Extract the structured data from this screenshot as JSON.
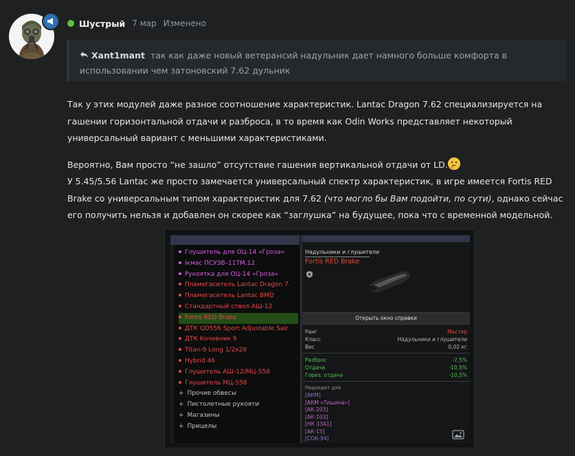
{
  "post": {
    "author": "Шустрый",
    "date": "7 мар",
    "edited": "Изменено",
    "quote": {
      "author": "Xant1mant",
      "text": "так как даже новый ветерансий надульник дает намного больше комфорта в использовании чем затоновский 7.62 дульник"
    },
    "paragraph1": "Так у этих модулей даже разное соотношение характеристик. Lantac Dragon 7.62 специализируется на гашении горизонтальной отдачи и разброса, в то время как Odin Works представляет некоторый универсальный вариант с меньшими характеристиками.",
    "paragraph2_line1": "Вероятно, Вам просто “не зашло” отсутствие гашения вертикальной отдачи от LD.",
    "paragraph2_rest_a": "У 5.45/5.56 Lantac же просто замечается универсальный спектр характеристик, в игре имеется Fortis RED Brake со универсальным типом характеристик для 7.62 ",
    "paragraph2_italic": "(что могло бы Вам подойти, по сути)",
    "paragraph2_rest_b": ", однако сейчас его получить нельзя и добавлен он скорее как “заглушка” на будущее, пока что с временной модельной."
  },
  "screenshot": {
    "list": [
      {
        "label": "Глушитель для ОЦ-14 «Гроза»",
        "color": "#d85ce0",
        "bullet": "#d85ce0"
      },
      {
        "label": "Ікмас ПСУЗВ–11ТМ.12",
        "color": "#d85ce0",
        "bullet": "#d85ce0"
      },
      {
        "label": "Рукоятка для ОЦ-14 «Гроза»",
        "color": "#d85ce0",
        "bullet": "#d85ce0"
      },
      {
        "label": "Пламегаситель Lantac Dragon 7.",
        "color": "#e8484a",
        "bullet": "#e8484a"
      },
      {
        "label": "Пламегаситель Lantac BMD",
        "color": "#e8484a",
        "bullet": "#e8484a"
      },
      {
        "label": "Стандартный ствол АШ-12",
        "color": "#e8484a",
        "bullet": "#e8484a"
      },
      {
        "label": "Fortis RED Brake",
        "color": "#e8484a",
        "bullet": "#e8484a",
        "selected": true
      },
      {
        "label": "ДТК QD556 Sport Adjustable Sair",
        "color": "#e8484a",
        "bullet": "#e8484a"
      },
      {
        "label": "ДТК Кочевник 9",
        "color": "#e8484a",
        "bullet": "#e8484a"
      },
      {
        "label": "Titan-9 Long 1/2x28",
        "color": "#e8484a",
        "bullet": "#e8484a"
      },
      {
        "label": "Hybrid 46",
        "color": "#e8484a",
        "bullet": "#e8484a"
      },
      {
        "label": "Глушитель АШ-12/МЦ-558",
        "color": "#e8484a",
        "bullet": "#e8484a"
      },
      {
        "label": "Глушитель МЦ-558",
        "color": "#e8484a",
        "bullet": "#e8484a"
      }
    ],
    "groups": [
      "Прочие обвесы",
      "Пистолетные рукояти",
      "Магазины",
      "Прицелы"
    ],
    "panel_title": "Надульники и глушители",
    "item_name": "Fortis RED Brake",
    "help_button": "Открыть окно справки",
    "rank_label": "Ранг",
    "rank_value": "Мастер",
    "class_label": "Класс",
    "class_value": "Надульники и глушители",
    "weight_label": "Вес",
    "weight_value": "0,02 кг",
    "spread_label": "Разброс",
    "spread_value": "-7,5%",
    "recoil_label": "Отдача",
    "recoil_value": "-10,5%",
    "horiz_label": "Гориз. отдача",
    "horiz_value": "-10,5%",
    "fits_title": "Подходит для",
    "fits": [
      {
        "label": "[АКМ]",
        "pink": false
      },
      {
        "label": "[АКМ «Тишина»]",
        "pink": true
      },
      {
        "label": "[АК-203]",
        "pink": true
      },
      {
        "label": "[АК-103]",
        "pink": true
      },
      {
        "label": "[НК 33А1]",
        "pink": true
      },
      {
        "label": "[АК-15]",
        "pink": true
      },
      {
        "label": "[СОК-94]",
        "pink": false
      }
    ]
  },
  "colors": {
    "online": "#5fc33f",
    "badge": "#2f6fb2",
    "rank": "#e24a3a",
    "stat_green": "#54c05a"
  }
}
